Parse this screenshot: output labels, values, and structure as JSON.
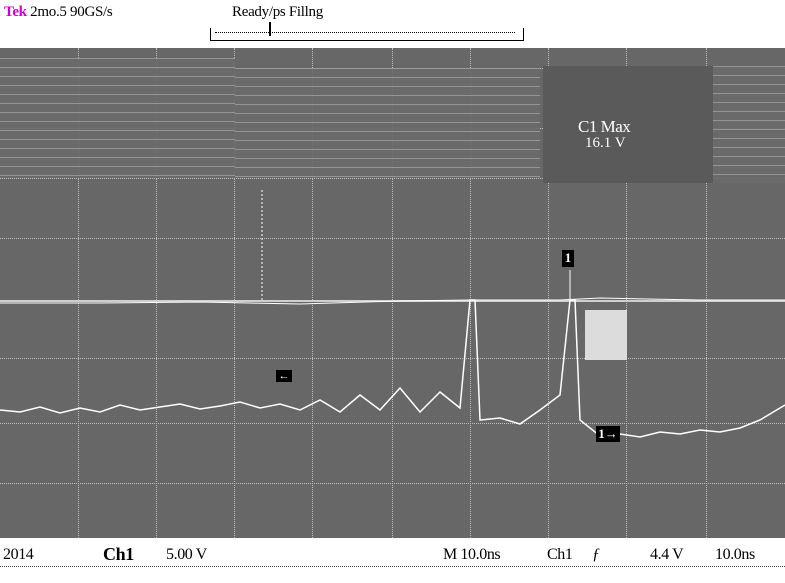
{
  "top_bar": {
    "brand_tek": "Tek",
    "brand_rest": " 2mo.5 90GS/s",
    "trigger_status": "Ready/ps    Fillng"
  },
  "measurement": {
    "label": "C1 Max",
    "value": "16.1 V"
  },
  "markers": {
    "ch1_marker": "1",
    "ch1_level_marker": "1→",
    "trigger_position": "←"
  },
  "status_bar": {
    "left": "2014",
    "channel": "Ch1",
    "volts_per_div": "5.00 V",
    "timebase": "M 10.0ns",
    "trigger_source": "Ch1",
    "trigger_slope": "ƒ",
    "trigger_level": "4.4 V",
    "sample_rate": "10.0ns"
  },
  "colors": {
    "screen_bg": "#676767",
    "grid": "#bfbfbf",
    "trace": "#ffffff",
    "brand_accent": "#d000d0"
  }
}
